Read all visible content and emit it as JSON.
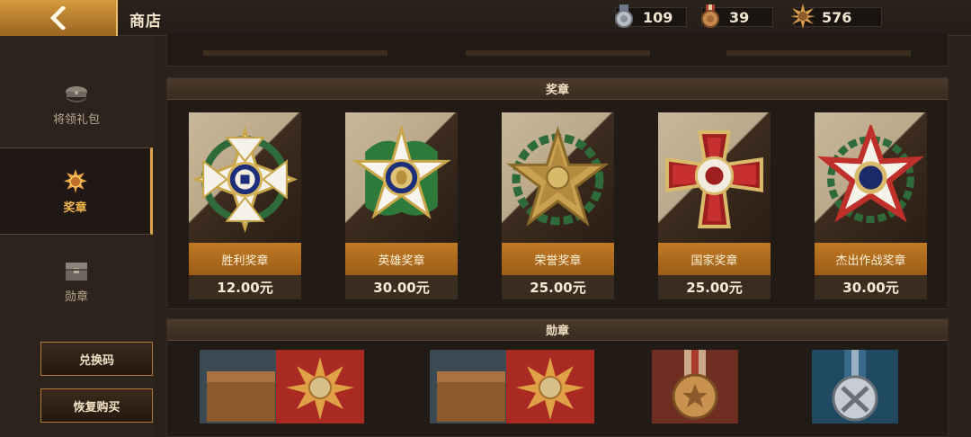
{
  "header": {
    "title": "商店",
    "currencies": [
      {
        "icon": "silver-medal-icon",
        "value": "109"
      },
      {
        "icon": "bronze-medal-icon",
        "value": "39"
      },
      {
        "icon": "gold-star-badge-icon",
        "value": "576"
      }
    ]
  },
  "sidebar": {
    "items": [
      {
        "label": "将领礼包",
        "icon": "officer-cap-icon",
        "active": false
      },
      {
        "label": "奖章",
        "icon": "sun-medal-icon",
        "active": true
      },
      {
        "label": "勋章",
        "icon": "chest-icon",
        "active": false
      }
    ],
    "redeem_label": "兑换码",
    "restore_label": "恢复购买"
  },
  "medals_section": {
    "title": "奖章",
    "items": [
      {
        "name": "胜利奖章",
        "price": "12.00元",
        "icon": "white-cross-medal-icon"
      },
      {
        "name": "英雄奖章",
        "price": "30.00元",
        "icon": "white-star-medal-icon"
      },
      {
        "name": "荣誉奖章",
        "price": "25.00元",
        "icon": "gold-star-medal-icon"
      },
      {
        "name": "国家奖章",
        "price": "25.00元",
        "icon": "red-cross-medal-icon"
      },
      {
        "name": "杰出作战奖章",
        "price": "30.00元",
        "icon": "red-white-star-medal-icon"
      }
    ]
  },
  "badges_section": {
    "title": "勋章",
    "items": [
      {
        "icon": "chest-sun-badge-icon"
      },
      {
        "icon": "chest-sun-badge-icon"
      },
      {
        "icon": "bronze-star-badge-icon"
      },
      {
        "icon": "silver-rifles-badge-icon"
      }
    ]
  },
  "colors": {
    "accent": "#e1a545",
    "card_name_bg": "#c17a24",
    "background": "#2a211b"
  }
}
